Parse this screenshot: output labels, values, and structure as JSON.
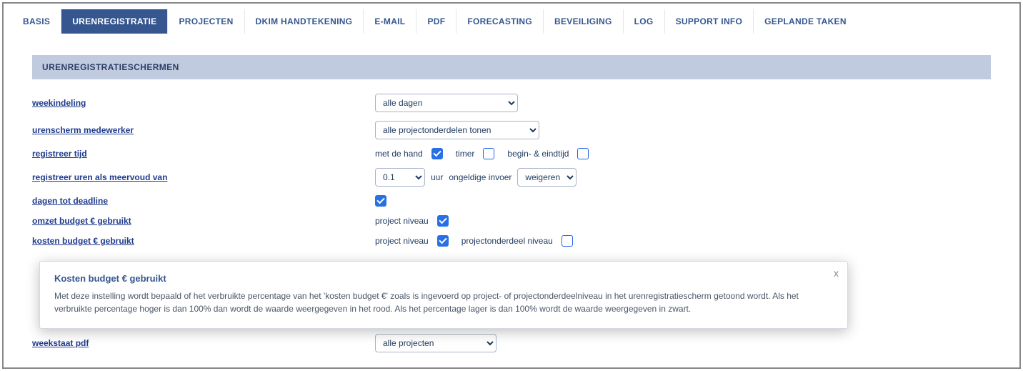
{
  "tabs": [
    {
      "label": "BASIS",
      "active": false
    },
    {
      "label": "URENREGISTRATIE",
      "active": true
    },
    {
      "label": "PROJECTEN",
      "active": false
    },
    {
      "label": "DKIM HANDTEKENING",
      "active": false
    },
    {
      "label": "E-MAIL",
      "active": false
    },
    {
      "label": "PDF",
      "active": false
    },
    {
      "label": "FORECASTING",
      "active": false
    },
    {
      "label": "BEVEILIGING",
      "active": false
    },
    {
      "label": "LOG",
      "active": false
    },
    {
      "label": "SUPPORT INFO",
      "active": false
    },
    {
      "label": "GEPLANDE TAKEN",
      "active": false
    }
  ],
  "section_header": "URENREGISTRATIESCHERMEN",
  "rows": {
    "weekindeling": {
      "label": "weekindeling",
      "select": "alle dagen"
    },
    "urenscherm": {
      "label": "urenscherm medewerker",
      "select": "alle projectonderdelen tonen"
    },
    "registreer_tijd": {
      "label": "registreer tijd",
      "opt1": "met de hand",
      "chk1": true,
      "opt2": "timer",
      "chk2": false,
      "opt3": "begin- & eindtijd",
      "chk3": false
    },
    "meervoud": {
      "label": "registreer uren als meervoud van",
      "sel1": "0.1",
      "txt1": "uur",
      "txt2": "ongeldige invoer",
      "sel2": "weigeren"
    },
    "deadline": {
      "label": "dagen tot deadline",
      "chk": true
    },
    "omzet": {
      "label": "omzet budget € gebruikt",
      "txt": "project niveau",
      "chk": true
    },
    "kosten": {
      "label": "kosten budget € gebruikt",
      "txt1": "project niveau",
      "chk1": true,
      "txt2": "projectonderdeel niveau",
      "chk2": false
    },
    "weekstaat": {
      "label": "weekstaat pdf",
      "select": "alle projecten"
    }
  },
  "popup": {
    "title": "Kosten budget € gebruikt",
    "body": "Met deze instelling wordt bepaald of het verbruikte percentage van het 'kosten budget €' zoals is ingevoerd op project- of projectonderdeelniveau in het urenregistratiescherm getoond wordt. Als het verbruikte percentage hoger is dan 100% dan wordt de waarde weergegeven in het rood. Als het percentage lager is dan 100% wordt de waarde weergegeven in zwart.",
    "close": "x"
  }
}
